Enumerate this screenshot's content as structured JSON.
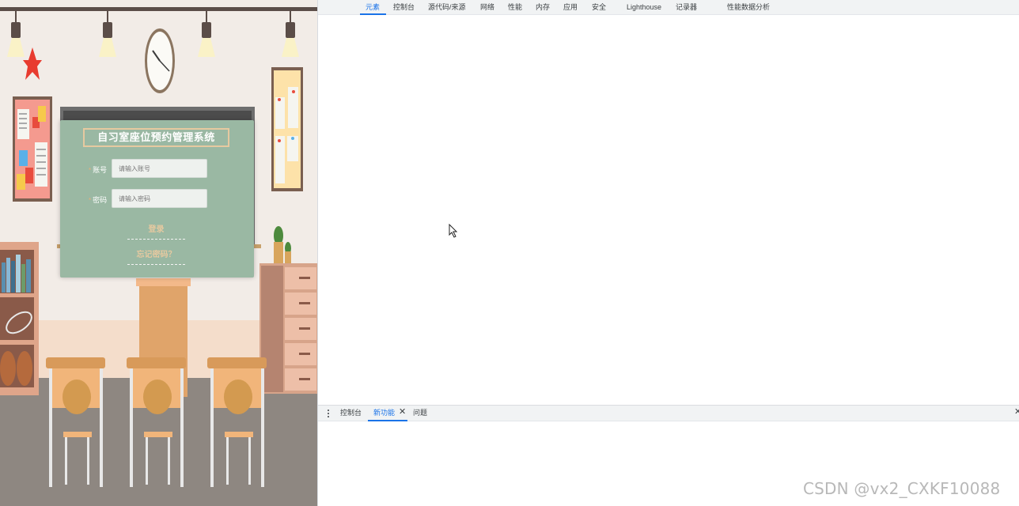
{
  "login": {
    "title": "自习室座位预约管理系统",
    "required_mark": "*",
    "account_label": "账号",
    "account_placeholder": "请输入账号",
    "password_label": "密码",
    "password_placeholder": "请输入密码",
    "login_button": "登录",
    "forgot_password": "忘记密码？"
  },
  "devtools": {
    "tabs": [
      "元素",
      "控制台",
      "源代码/来源",
      "网络",
      "性能",
      "内存",
      "应用",
      "安全",
      "Lighthouse",
      "记录器",
      "性能数据分析"
    ],
    "active_tab": "元素",
    "drawer_tabs": [
      "控制台",
      "新功能",
      "问题"
    ],
    "active_drawer_tab": "新功能",
    "close_glyph": "✕",
    "accent_color": "#1a73e8"
  },
  "watermark": "CSDN @vx2_CXKF10088",
  "colors": {
    "board": "#9ab8a3",
    "title_border": "#e6c9a0",
    "link_text": "#e6c9a0"
  }
}
